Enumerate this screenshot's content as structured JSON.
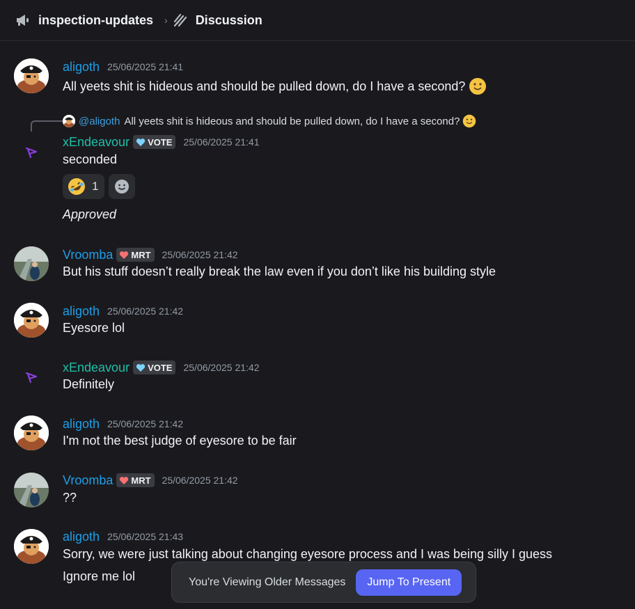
{
  "header": {
    "channel_name": "inspection-updates",
    "thread_name": "Discussion",
    "channel_icon": "megaphone-icon",
    "thread_icon": "thread-icon"
  },
  "messages": [
    {
      "author": "aligoth",
      "timestamp": "25/06/2025 21:41",
      "text": "All yeets shit is hideous and should be pulled down, do I have a second?",
      "emoji": "slightly-smiling-face"
    },
    {
      "author": "xEndeavour",
      "badge": "VOTE",
      "timestamp": "25/06/2025 21:41",
      "reply": {
        "mention": "@aligoth",
        "text": "All yeets shit is hideous and should be pulled down, do I have a second?"
      },
      "text": "seconded",
      "reactions": [
        {
          "emoji": "rolling-on-floor-laughing",
          "count": "1"
        }
      ],
      "followup": "Approved"
    },
    {
      "author": "Vroomba",
      "badge": "MRT",
      "timestamp": "25/06/2025 21:42",
      "text": "But his stuff doesn’t really break the law even if you don’t like his building style"
    },
    {
      "author": "aligoth",
      "timestamp": "25/06/2025 21:42",
      "text": "Eyesore lol"
    },
    {
      "author": "xEndeavour",
      "badge": "VOTE",
      "timestamp": "25/06/2025 21:42",
      "text": "Definitely"
    },
    {
      "author": "aligoth",
      "timestamp": "25/06/2025 21:42",
      "text": "I'm not the best judge of eyesore to be fair"
    },
    {
      "author": "Vroomba",
      "badge": "MRT",
      "timestamp": "25/06/2025 21:42",
      "text": "??"
    },
    {
      "author": "aligoth",
      "timestamp": "25/06/2025 21:43",
      "text": "Sorry, we were just talking about changing eyesore process and I was being silly I guess",
      "text2": "Ignore me lol"
    }
  ],
  "toast": {
    "text": "You're Viewing Older Messages",
    "button": "Jump To Present"
  },
  "colors": {
    "background": "#1a1a1e",
    "username_blue": "#1e9ee8",
    "username_teal": "#1fbfa8",
    "accent_button": "#5865f2",
    "vote_heart": "#7dd3fc",
    "mrt_heart": "#f87171"
  }
}
